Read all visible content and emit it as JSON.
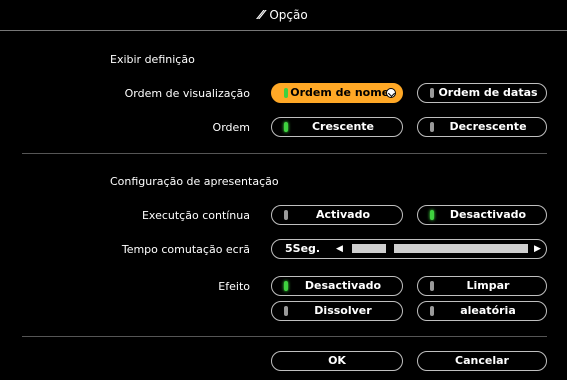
{
  "title": {
    "text": "Opção",
    "icon": "wrench-icon"
  },
  "display_section": {
    "heading": "Exibir definição",
    "view_order": {
      "label": "Ordem de visualização",
      "options": [
        {
          "label": "Ordem de nomes",
          "state": "focused"
        },
        {
          "label": "Ordem de datas",
          "state": "off"
        }
      ]
    },
    "order": {
      "label": "Ordem",
      "options": [
        {
          "label": "Crescente",
          "state": "on"
        },
        {
          "label": "Decrescente",
          "state": "off"
        }
      ]
    }
  },
  "presentation_section": {
    "heading": "Configuração de apresentação",
    "continuous": {
      "label": "Executção contínua",
      "options": [
        {
          "label": "Activado",
          "state": "off"
        },
        {
          "label": "Desactivado",
          "state": "on"
        }
      ]
    },
    "switch_time": {
      "label": "Tempo comutação ecrã",
      "value": "5Seg.",
      "level_fraction": 0.2
    },
    "effect": {
      "label": "Efeito",
      "options": [
        {
          "label": "Desactivado",
          "state": "on"
        },
        {
          "label": "Limpar",
          "state": "off"
        },
        {
          "label": "Dissolver",
          "state": "off"
        },
        {
          "label": "aleatória",
          "state": "off"
        }
      ]
    }
  },
  "footer": {
    "ok_label": "OK",
    "cancel_label": "Cancelar"
  },
  "colors": {
    "focus": "#ffa826",
    "indicator_on": "#3fd13f",
    "indicator_off": "#9a9a9a",
    "border": "#bfbfbf"
  }
}
